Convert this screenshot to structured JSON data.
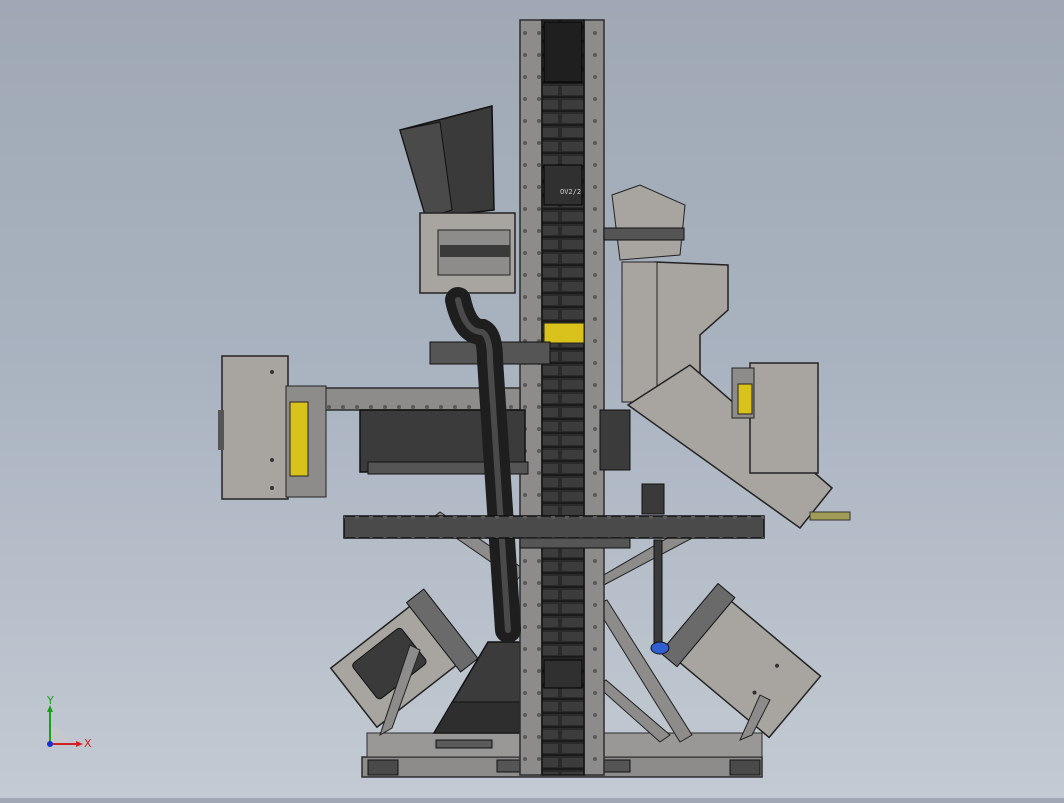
{
  "viewport": {
    "background": "#a6afbb",
    "colors": {
      "frame_steel": "#8e8c8a",
      "dark_part": "#3a3a3a",
      "belt": "#2b2b2b",
      "housing": "#a9a6a0",
      "highlight_yellow": "#d9c21c",
      "accent_blue": "#2f5fd0"
    }
  },
  "model": {
    "labels": {
      "chute_label": "OV2/2"
    }
  },
  "triad": {
    "x_label": "X",
    "y_label": "Y",
    "x_color": "#d42020",
    "y_color": "#18a018",
    "z_color": "#1830d0"
  }
}
